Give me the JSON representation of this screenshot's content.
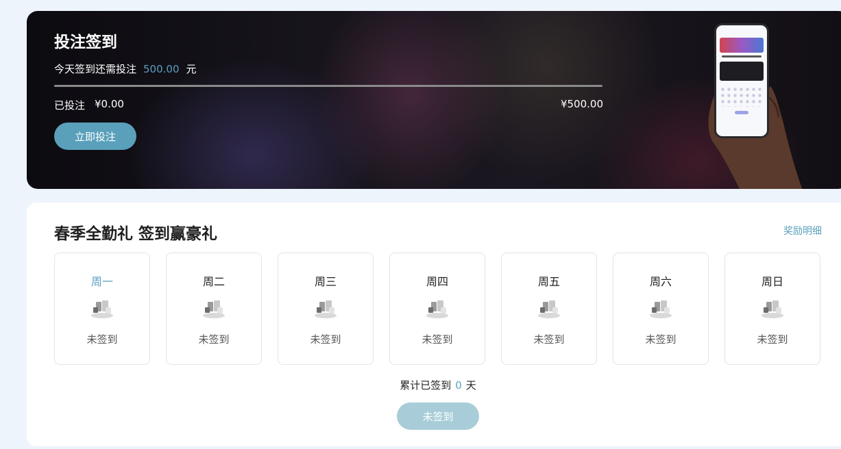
{
  "banner": {
    "title": "投注签到",
    "need_prefix": "今天签到还需投注",
    "need_amount": "500.00",
    "need_unit": "元",
    "progress": 0,
    "bet_label": "已投注",
    "bet_amount": "¥0.00",
    "target_amount": "¥500.00",
    "bet_button": "立即投注"
  },
  "signin": {
    "title": "春季全勤礼 签到赢豪礼",
    "detail_link": "奖励明细",
    "days": [
      {
        "label": "周一",
        "status": "未签到"
      },
      {
        "label": "周二",
        "status": "未签到"
      },
      {
        "label": "周三",
        "status": "未签到"
      },
      {
        "label": "周四",
        "status": "未签到"
      },
      {
        "label": "周五",
        "status": "未签到"
      },
      {
        "label": "周六",
        "status": "未签到"
      },
      {
        "label": "周日",
        "status": "未签到"
      }
    ],
    "total_prefix": "累计已签到",
    "total_days": "0",
    "total_unit": "天",
    "sign_button": "未签到"
  },
  "colors": {
    "accent": "#5ba0bf",
    "button": "#5aa0bb",
    "sign_disabled": "#a8cdd8"
  },
  "icons": {
    "gift": "gift-products-icon"
  }
}
